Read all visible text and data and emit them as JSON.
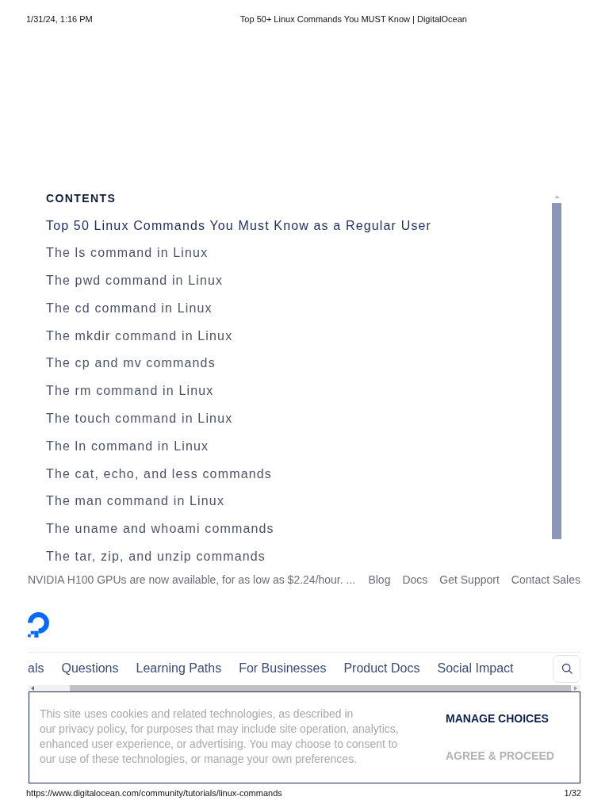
{
  "print_header": {
    "date": "1/31/24, 1:16 PM",
    "title": "Top 50+ Linux Commands You MUST Know | DigitalOcean"
  },
  "contents": {
    "heading": "CONTENTS",
    "items": [
      {
        "label": "Top 50 Linux Commands You Must Know as a Regular User",
        "selected": true
      },
      {
        "label": "The ls command in Linux",
        "selected": false
      },
      {
        "label": "The pwd command in Linux",
        "selected": false
      },
      {
        "label": "The cd command in Linux",
        "selected": false
      },
      {
        "label": "The mkdir command in Linux",
        "selected": false
      },
      {
        "label": "The cp and mv commands",
        "selected": false
      },
      {
        "label": "The rm command in Linux",
        "selected": false
      },
      {
        "label": "The touch command in Linux",
        "selected": false
      },
      {
        "label": "The ln command in Linux",
        "selected": false
      },
      {
        "label": "The cat, echo, and less commands",
        "selected": false
      },
      {
        "label": "The man command in Linux",
        "selected": false
      },
      {
        "label": "The uname and whoami commands",
        "selected": false
      },
      {
        "label": "The tar, zip, and unzip commands",
        "selected": false
      }
    ]
  },
  "top_bar": {
    "announcement": "NVIDIA H100 GPUs are now available, for as low as $2.24/hour. ...",
    "links": [
      "Blog",
      "Docs",
      "Get Support",
      "Contact Sales"
    ]
  },
  "nav": {
    "items": [
      "als",
      "Questions",
      "Learning Paths",
      "For Businesses",
      "Product Docs",
      "Social Impact"
    ]
  },
  "cookie_banner": {
    "text": "This site uses cookies and related technologies, as described in\nour privacy policy, for purposes that may include site operation, analytics,\nenhanced user experience, or advertising. You may choose to consent to\nour use of these technologies, or manage your own preferences.",
    "buttons": [
      {
        "label": "MANAGE CHOICES",
        "kind": "primary"
      },
      {
        "label": "AGREE & PROCEED",
        "kind": "muted"
      }
    ]
  },
  "print_footer": {
    "url": "https://www.digitalocean.com/community/tutorials/linux-commands",
    "page": "1/32"
  }
}
